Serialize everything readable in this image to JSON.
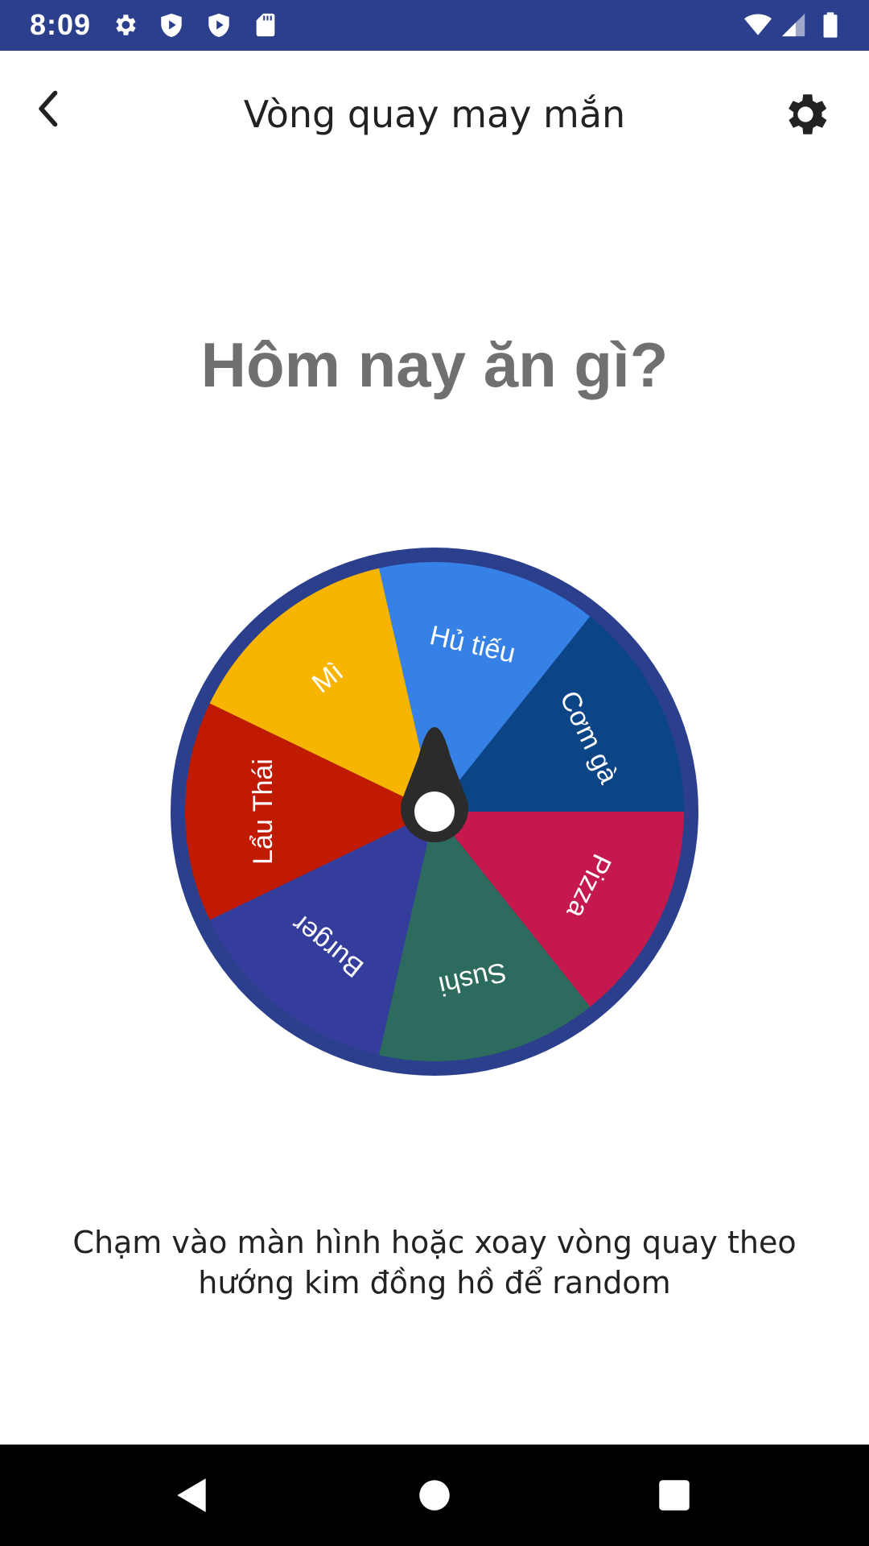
{
  "status_bar": {
    "time": "8:09",
    "left_icons": [
      "gear-icon",
      "shield-play-icon",
      "shield-play-icon",
      "sd-card-icon"
    ],
    "right_icons": [
      "wifi-icon",
      "signal-icon",
      "battery-icon"
    ]
  },
  "app_bar": {
    "title": "Vòng quay may mắn",
    "back_icon": "chevron-left-icon",
    "settings_icon": "gear-icon"
  },
  "headline": "Hôm nay ăn gì?",
  "wheel": {
    "rim_color": "#2b3f8c",
    "pointer_color": "#2b2b2b",
    "segments": [
      {
        "label": "Hủ tiếu",
        "color": "#3681e6"
      },
      {
        "label": "Cơm gà",
        "color": "#0c4585"
      },
      {
        "label": "Pizza",
        "color": "#c5194e"
      },
      {
        "label": "Sushi",
        "color": "#2d6b5e"
      },
      {
        "label": "Burger",
        "color": "#353d9c"
      },
      {
        "label": "Lẩu Thái",
        "color": "#c01a00"
      },
      {
        "label": "Mì",
        "color": "#f7b500"
      }
    ]
  },
  "hint": "Chạm vào màn hình hoặc xoay vòng quay theo hướng kim đồng hồ để random",
  "nav_bar": {
    "icons": [
      "back-triangle-icon",
      "home-circle-icon",
      "recents-square-icon"
    ]
  }
}
